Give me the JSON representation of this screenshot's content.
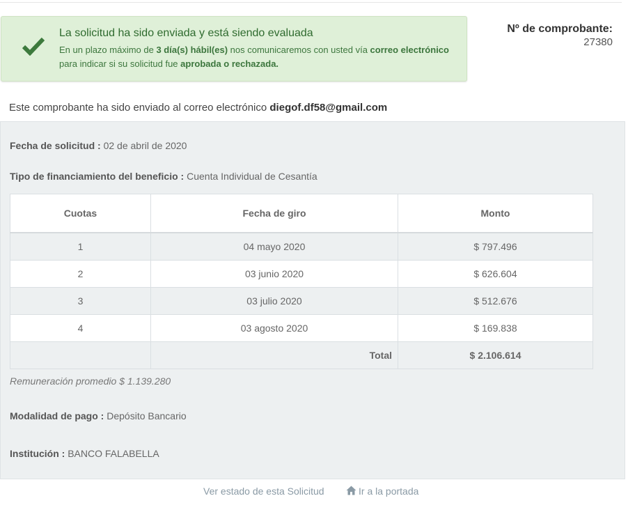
{
  "alert": {
    "title": "La solicitud ha sido enviada y está siendo evaluada",
    "body_p1": "En un plazo máximo de ",
    "body_b1": "3 día(s) hábil(es)",
    "body_p2": " nos comunicaremos con usted vía ",
    "body_b2": "correo electrónico",
    "body_p3": " para indicar si su solicitud fue ",
    "body_b3": "aprobada o rechazada."
  },
  "voucher": {
    "label": "Nº de comprobante:",
    "number": "27380"
  },
  "sent_note": {
    "text": "Este comprobante ha sido enviado al correo electrónico ",
    "email": "diegof.df58@gmail.com"
  },
  "fields": {
    "fecha_label": "Fecha de solicitud :",
    "fecha_value": " 02 de abril de 2020",
    "tipo_label": "Tipo de financiamiento del beneficio :",
    "tipo_value": " Cuenta Individual de Cesantía",
    "remuneracion": "Remuneración promedio $ 1.139.280",
    "modalidad_label": "Modalidad de pago :",
    "modalidad_value": " Depósito Bancario",
    "institucion_label": "Institución :",
    "institucion_value": " BANCO FALABELLA"
  },
  "table": {
    "headers": [
      "Cuotas",
      "Fecha de giro",
      "Monto"
    ],
    "rows": [
      [
        "1",
        "04 mayo 2020",
        "$ 797.496"
      ],
      [
        "2",
        "03 junio 2020",
        "$ 626.604"
      ],
      [
        "3",
        "03 julio 2020",
        "$ 512.676"
      ],
      [
        "4",
        "03 agosto 2020",
        "$ 169.838"
      ]
    ],
    "total_label": "Total",
    "total_value": "$ 2.106.614"
  },
  "footer": {
    "estado_link": "Ver estado de esta Solicitud",
    "portada_link": "Ir a la portada"
  },
  "colors": {
    "success_bg": "#dff0d8",
    "success_text": "#3c763d",
    "check": "#3d7a3d",
    "panel_bg": "#edf0f1"
  },
  "icons": {
    "alert": "check-icon",
    "portada": "home-icon"
  }
}
